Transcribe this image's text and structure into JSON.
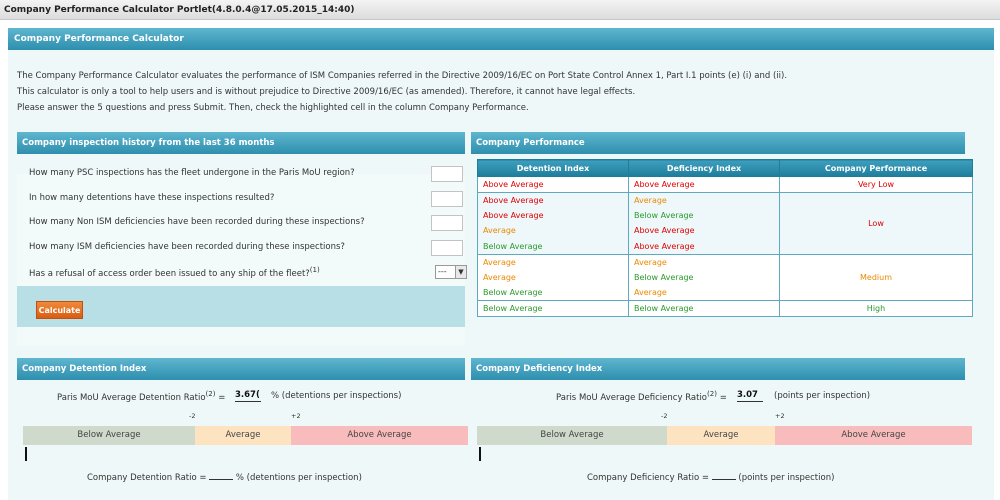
{
  "portlet_title": "Company Performance Calculator Portlet(4.8.0.4@17.05.2015_14:40)",
  "main_header": "Company Performance Calculator",
  "intro": [
    "The Company Performance Calculator evaluates the performance of ISM Companies referred in the Directive 2009/16/EC on Port State Control Annex 1, Part I.1 points (e) (i) and (ii).",
    "This calculator is only a tool to help users and is without prejudice to Directive 2009/16/EC (as amended). Therefore, it cannot have legal effects.",
    "Please answer the 5 questions and press Submit. Then, check the highlighted cell in the column Company Performance."
  ],
  "inspection": {
    "header": "Company inspection history from the last 36 months",
    "questions": [
      "How many PSC inspections has the fleet undergone in the Paris MoU region?",
      "In how many detentions have these inspections resulted?",
      "How many Non ISM deficiencies have been recorded during these inspections?",
      "How many ISM deficiencies have been recorded during these inspections?",
      "Has a refusal of access order been issued to any ship of the fleet?"
    ],
    "q5_sup": "(1)",
    "select_value": "---",
    "calculate_label": "Calculate"
  },
  "performance": {
    "header": "Company Performance",
    "columns": [
      "Detention Index",
      "Deficiency Index",
      "Company Performance"
    ],
    "rows": [
      {
        "det": "Above Average",
        "det_c": "red",
        "def": "Above Average",
        "def_c": "red"
      },
      {
        "det": "Above Average",
        "det_c": "red",
        "def": "Average",
        "def_c": "orange"
      },
      {
        "det": "Above Average",
        "det_c": "red",
        "def": "Below Average",
        "def_c": "green"
      },
      {
        "det": "Average",
        "det_c": "orange",
        "def": "Above Average",
        "def_c": "red"
      },
      {
        "det": "Below Average",
        "det_c": "green",
        "def": "Above Average",
        "def_c": "red"
      },
      {
        "det": "Average",
        "det_c": "orange",
        "def": "Average",
        "def_c": "orange"
      },
      {
        "det": "Average",
        "det_c": "orange",
        "def": "Below Average",
        "def_c": "green"
      },
      {
        "det": "Below Average",
        "det_c": "green",
        "def": "Average",
        "def_c": "orange"
      },
      {
        "det": "Below Average",
        "det_c": "green",
        "def": "Below Average",
        "def_c": "green"
      }
    ],
    "results": [
      "Very Low",
      "Low",
      "Medium",
      "High"
    ]
  },
  "detention": {
    "header": "Company Detention Index",
    "ratio_label": "Paris MoU Average Detention Ratio",
    "ratio_sup": "(2)",
    "eq": "=",
    "ratio_value": "3.67(",
    "ratio_unit": "% (detentions per inspections)",
    "tick_minus": "-2",
    "tick_plus": "+2",
    "bands": [
      "Below Average",
      "Average",
      "Above Average"
    ],
    "company_label": "Company Detention Ratio =",
    "company_unit": "% (detentions per inspection)"
  },
  "deficiency": {
    "header": "Company Deficiency Index",
    "ratio_label": "Paris MoU Average Deficiency Ratio",
    "ratio_sup": "(2)",
    "eq": "=",
    "ratio_value": "3.07",
    "ratio_unit": "(points per inspection)",
    "tick_minus": "-2",
    "tick_plus": "+2",
    "bands": [
      "Below Average",
      "Average",
      "Above Average"
    ],
    "company_label": "Company Deficiency Ratio =",
    "company_unit": "(points per inspection)"
  },
  "colors": {
    "header_blue": "#2d8fae",
    "band_below": "#cfd9cc",
    "band_average": "#fde3c0",
    "band_above": "#f9bcbc",
    "button_orange": "#e0671c"
  }
}
